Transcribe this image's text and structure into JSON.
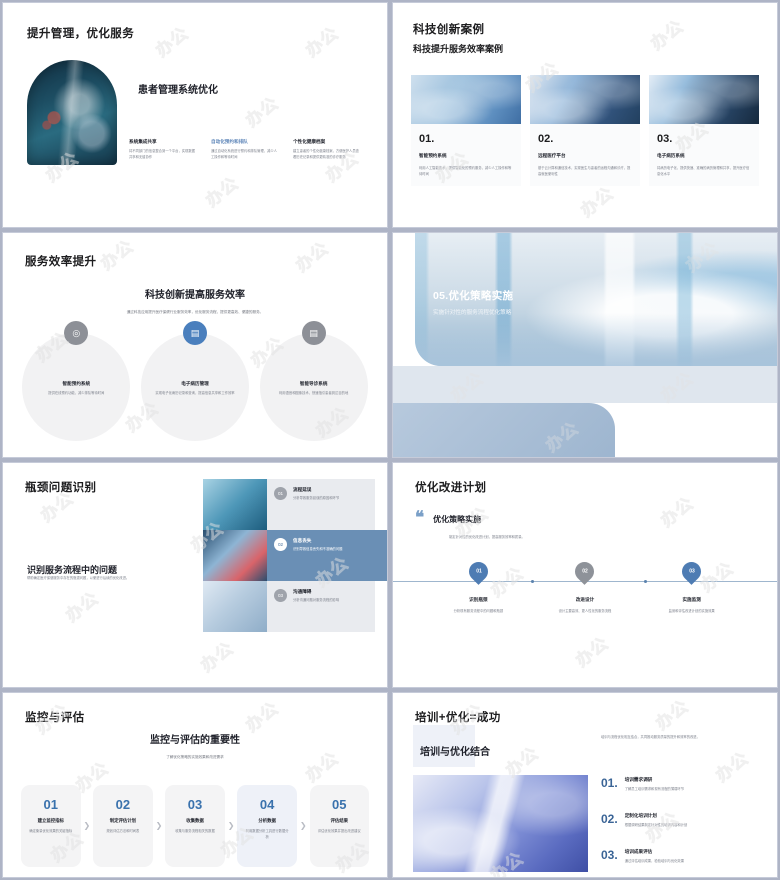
{
  "watermark": "办公",
  "colors": {
    "accent": "#5d85b8",
    "deep_blue": "#3a6496",
    "bg": "#aeb4c6",
    "panel_gray": "#e9ebef"
  },
  "slides": [
    {
      "id": "slide-1",
      "title": "提升管理，优化服务",
      "heading": "患者管理系统优化",
      "columns": [
        {
          "label": "系统集成共享",
          "desc": "将不同部门的信息整合到一个平台，实现数据共享和无缝协作"
        },
        {
          "label": "自动化预约和排队",
          "desc": "通过自动化系统进行预约和排队管理，减少人工操作和等待时间",
          "highlight": true
        },
        {
          "label": "个性化健康档案",
          "desc": "建立患者的个性化健康档案，方便医护人员查看历史记录和提供更精准的诊疗服务"
        }
      ]
    },
    {
      "id": "slide-2",
      "title": "科技创新案例",
      "heading": "科技提升服务效率案例",
      "cards": [
        {
          "num": "01.",
          "label": "智能预约系统",
          "desc": "利用人工智能技术，提供智能化的预约服务，减少人工操作和等待时间",
          "highlight": false
        },
        {
          "num": "02.",
          "label": "远程医疗平台",
          "desc": "基于云计算和通信技术，实现医生与患者的远程沟通和诊疗，提高就医便利性",
          "highlight": true
        },
        {
          "num": "03.",
          "label": "电子病历系统",
          "desc": "将病历电子化，提供快速、准确的病历管理和共享，提升医疗信息化水平",
          "highlight": false
        }
      ]
    },
    {
      "id": "slide-3",
      "title": "服务效率提升",
      "heading": "科技创新提高服务效率",
      "subtitle": "通过科技应用提升医疗保健行业服务效率，优化服务流程，提供更高效、便捷的服务。",
      "items": [
        {
          "icon": "target-icon",
          "glyph": "◎",
          "icon_color": "#8d9097",
          "label": "智能预约系统",
          "desc": "提供在线预约功能，减少排队等待时间"
        },
        {
          "icon": "folder-icon",
          "glyph": "▤",
          "icon_color": "#4a7fbd",
          "label": "电子病历管理",
          "desc": "实现电子化病历记录和查询，提高信息共享和工作效率"
        },
        {
          "icon": "document-icon",
          "glyph": "▤",
          "icon_color": "#8d9097",
          "label": "智能导诊系统",
          "desc": "利用语音和图像技术，快速指引患者到达目的地"
        }
      ]
    },
    {
      "id": "slide-4",
      "caption_title": "05.优化策略实施",
      "caption_sub": "实施针对性的服务流程优化策略"
    },
    {
      "id": "slide-5",
      "title": "瓶颈问题识别",
      "heading": "识别服务流程中的问题",
      "desc": "帮助确定医疗保健服务中存在的瓶颈问题，以便进行后续的优化改进。",
      "rows": [
        {
          "num": "01",
          "label": "流程延误",
          "desc": "分析导致服务延误的原因和环节",
          "active": false
        },
        {
          "num": "02",
          "label": "信息丢失",
          "desc": "识别导致信息丢失和不准确的问题",
          "active": true
        },
        {
          "num": "03",
          "label": "沟通障碍",
          "desc": "分析沟通问题对服务流程的影响",
          "active": false
        }
      ],
      "chevron": "»"
    },
    {
      "id": "slide-6",
      "title": "优化改进计划",
      "heading": "优化策略实施",
      "quote_mark": "❝",
      "desc": "制定针对性的优化改进计划，提高服务效率和质量。",
      "steps": [
        {
          "num": "01",
          "label": "识别瓶颈",
          "desc": "分析现有服务流程中的问题和瓶颈",
          "color": "#4e7cb3"
        },
        {
          "num": "02",
          "label": "改进设计",
          "desc": "设计主要高效、更人性化的服务流程",
          "color": "#8e9299"
        },
        {
          "num": "03",
          "label": "实施监测",
          "desc": "监测和评估改进计划的实施效果",
          "color": "#4e7cb3"
        }
      ]
    },
    {
      "id": "slide-7",
      "title": "监控与评估",
      "heading": "监控与评估的重要性",
      "subtitle": "了解优化策略的实施效果和改进需求",
      "steps": [
        {
          "num": "01",
          "label": "建立监控指标",
          "desc": "确定衡量优化效果的关键指标",
          "alt": false
        },
        {
          "num": "02",
          "label": "制定评估计划",
          "desc": "规划评估方法和时间表",
          "alt": false
        },
        {
          "num": "03",
          "label": "收集数据",
          "desc": "收集与服务流程相关的数据",
          "alt": false
        },
        {
          "num": "04",
          "label": "分析数据",
          "desc": "利用数据分析工具进行数据分析",
          "alt": true
        },
        {
          "num": "05",
          "label": "评估结果",
          "desc": "评估优化效果并提出改进建议",
          "alt": false
        }
      ],
      "separator": "❯"
    },
    {
      "id": "slide-8",
      "title": "培训+优化=成功",
      "heading": "培训与优化结合",
      "desc": "培训与流程优化相互结合，共同推动服务质量的提升和效率的改进。",
      "items": [
        {
          "num": "01.",
          "label": "培训需求调研",
          "desc": "了解员工培训需求和现有流程的薄弱环节"
        },
        {
          "num": "02.",
          "label": "定制化培训计划",
          "desc": "根据调研结果制定针对性的培训内容和计划"
        },
        {
          "num": "03.",
          "label": "培训成果评估",
          "desc": "通过评估培训成果，检验培训与优化效果"
        }
      ]
    }
  ]
}
